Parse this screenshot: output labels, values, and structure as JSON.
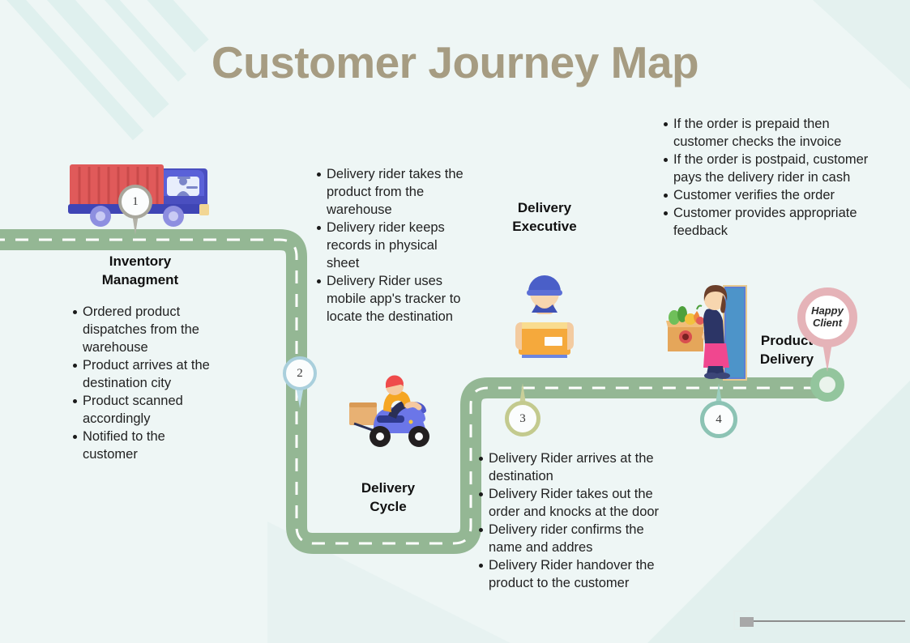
{
  "page": {
    "title": "Customer Journey Map",
    "background_color": "#eef6f5",
    "title_color": "#a69c82",
    "road_color": "#94b794"
  },
  "markers": [
    {
      "number": "1",
      "ring_color": "#a8a79c",
      "name": "marker-1"
    },
    {
      "number": "2",
      "ring_color": "#a9cfdc",
      "name": "marker-2"
    },
    {
      "number": "3",
      "ring_color": "#c3ca8e",
      "name": "marker-3"
    },
    {
      "number": "4",
      "ring_color": "#8cc3b4",
      "name": "marker-4"
    }
  ],
  "end_marker": {
    "line1": "Happy",
    "line2": "Client",
    "ring_color": "#e5b3b8",
    "base_color": "#93c59d"
  },
  "sections": [
    {
      "id": "inventory",
      "heading_line1": "Inventory",
      "heading_line2": "Managment",
      "bullets": [
        "Ordered product dispatches from the warehouse",
        "Product arrives at the destination city",
        "Product scanned accordingly",
        "Notified to the customer"
      ]
    },
    {
      "id": "delivery-cycle",
      "heading_line1": "Delivery",
      "heading_line2": "Cycle",
      "bullets": [
        "Delivery rider takes the product from the warehouse",
        "Delivery rider keeps records in physical sheet",
        "Delivery Rider uses mobile app's tracker to locate the destination"
      ]
    },
    {
      "id": "delivery-executive",
      "heading_line1": "Delivery",
      "heading_line2": "Executive",
      "bullets": [
        "If the order is prepaid then customer checks the invoice",
        "If the order is postpaid, customer pays the delivery rider in cash",
        "Customer verifies the order",
        "Customer provides appropriate feedback"
      ]
    },
    {
      "id": "product-delivery",
      "heading_line1": "Product",
      "heading_line2": "Delivery",
      "bullets": [
        "Delivery Rider arrives at the destination",
        "Delivery Rider takes out the order and knocks at the door",
        "Delivery rider confirms the name and addres",
        "Delivery Rider handover the product to the customer"
      ]
    }
  ],
  "illustrations": [
    {
      "name": "delivery-truck-illustration",
      "label": "delivery truck"
    },
    {
      "name": "scooter-rider-illustration",
      "label": "delivery rider on scooter"
    },
    {
      "name": "delivery-executive-illustration",
      "label": "delivery executive holding box"
    },
    {
      "name": "customer-doorstep-illustration",
      "label": "customer receiving grocery box at door"
    }
  ]
}
